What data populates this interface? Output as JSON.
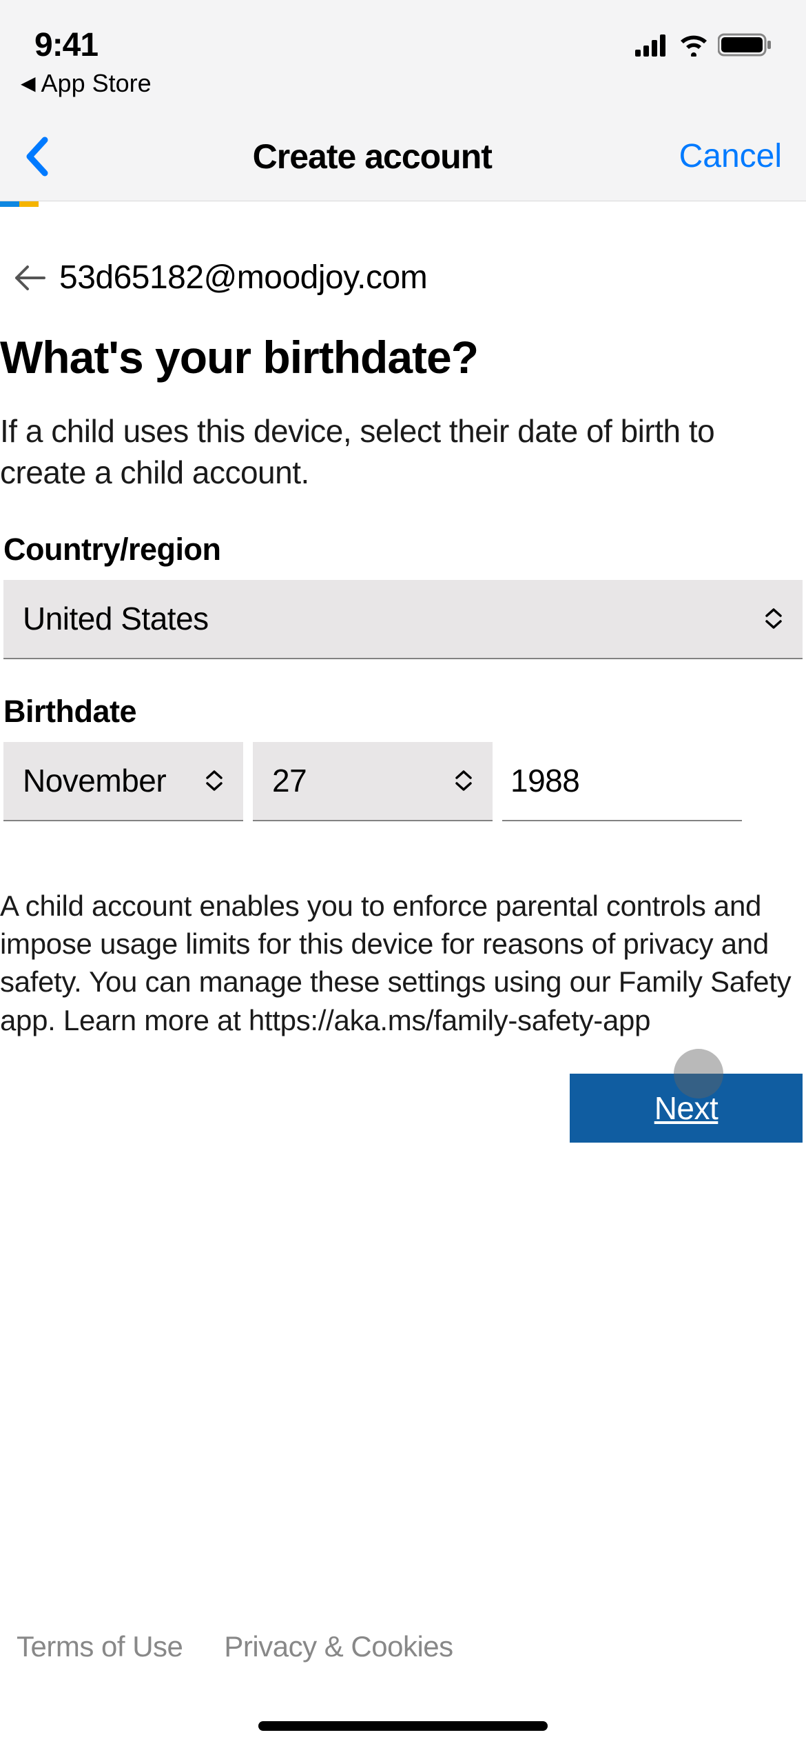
{
  "status": {
    "time": "9:41"
  },
  "back_to_app": {
    "label": "App Store"
  },
  "nav": {
    "title": "Create account",
    "cancel": "Cancel"
  },
  "email_row": {
    "email": "53d65182@moodjoy.com"
  },
  "form": {
    "heading": "What's your birthdate?",
    "subtext": "If a child uses this device, select their date of birth to create a child account.",
    "country_label": "Country/region",
    "country_value": "United States",
    "birthdate_label": "Birthdate",
    "month_value": "November",
    "day_value": "27",
    "year_value": "1988",
    "disclaimer": "A child account enables you to enforce parental controls and impose usage limits for this device for reasons of privacy and safety. You can manage these settings using our Family Safety app. Learn more at https://aka.ms/family-safety-app",
    "next_label": "Next"
  },
  "footer": {
    "terms": "Terms of Use",
    "privacy": "Privacy & Cookies"
  }
}
